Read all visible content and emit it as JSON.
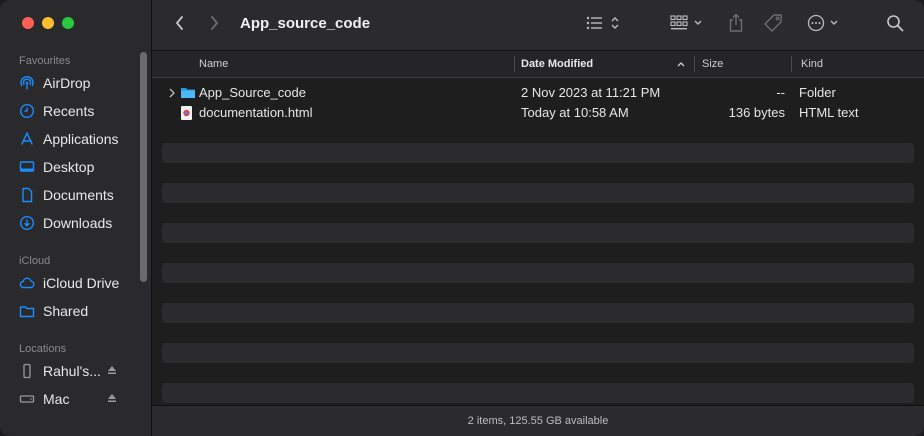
{
  "window": {
    "title": "App_source_code"
  },
  "sidebar": {
    "favourites_title": "Favourites",
    "favourites": [
      {
        "label": "AirDrop",
        "icon": "airdrop-icon"
      },
      {
        "label": "Recents",
        "icon": "clock-icon"
      },
      {
        "label": "Applications",
        "icon": "applications-icon"
      },
      {
        "label": "Desktop",
        "icon": "desktop-icon"
      },
      {
        "label": "Documents",
        "icon": "document-icon"
      },
      {
        "label": "Downloads",
        "icon": "download-icon"
      }
    ],
    "icloud_title": "iCloud",
    "icloud": [
      {
        "label": "iCloud Drive",
        "icon": "cloud-icon"
      },
      {
        "label": "Shared",
        "icon": "shared-folder-icon"
      }
    ],
    "locations_title": "Locations",
    "locations": [
      {
        "label": "Rahul's...",
        "icon": "phone-icon"
      },
      {
        "label": "Mac",
        "icon": "disk-icon"
      }
    ]
  },
  "columns": {
    "name": "Name",
    "date_modified": "Date Modified",
    "size": "Size",
    "kind": "Kind"
  },
  "files": [
    {
      "name": "App_Source_code",
      "date": "2 Nov 2023 at 11:21 PM",
      "size": "--",
      "kind": "Folder",
      "icon": "folder-icon"
    },
    {
      "name": "documentation.html",
      "date": "Today at 10:58 AM",
      "size": "136 bytes",
      "kind": "HTML text",
      "icon": "html-file-icon"
    }
  ],
  "status": "2 items, 125.55 GB available",
  "colors": {
    "accent": "#1a8cff",
    "folder": "#35a8f5"
  }
}
